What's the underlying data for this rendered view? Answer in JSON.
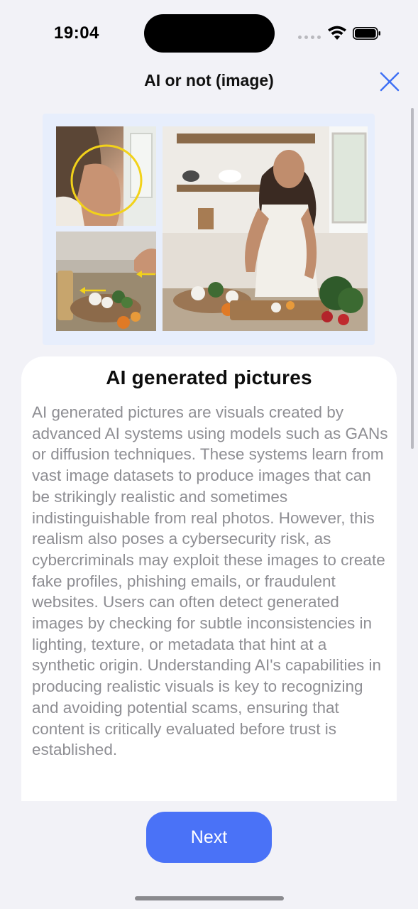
{
  "status_bar": {
    "time": "19:04"
  },
  "nav": {
    "title": "AI or not (image)",
    "close_icon": "close-icon"
  },
  "illustration": {
    "description_icon": "woman-cooking-photo",
    "accent_color": "#f2d21a"
  },
  "card": {
    "title": "AI generated pictures",
    "body": "AI generated pictures are visuals created by advanced AI systems using models such as GANs or diffusion techniques. These systems learn from vast image datasets to produce images that can be strikingly realistic and sometimes indistinguishable from real photos. However, this realism also poses a cybersecurity risk, as cybercriminals may exploit these images to create fake profiles, phishing emails, or fraudulent websites. Users can often detect generated images by checking for subtle inconsistencies in lighting, texture, or metadata that hint at a synthetic origin. Understanding AI's capabilities in producing realistic visuals is key to recognizing and avoiding potential scams, ensuring that content is critically evaluated before trust is established."
  },
  "actions": {
    "next_label": "Next"
  },
  "colors": {
    "accent": "#4a72f7",
    "close_icon": "#3d6ff5",
    "background": "#f2f2f7"
  }
}
